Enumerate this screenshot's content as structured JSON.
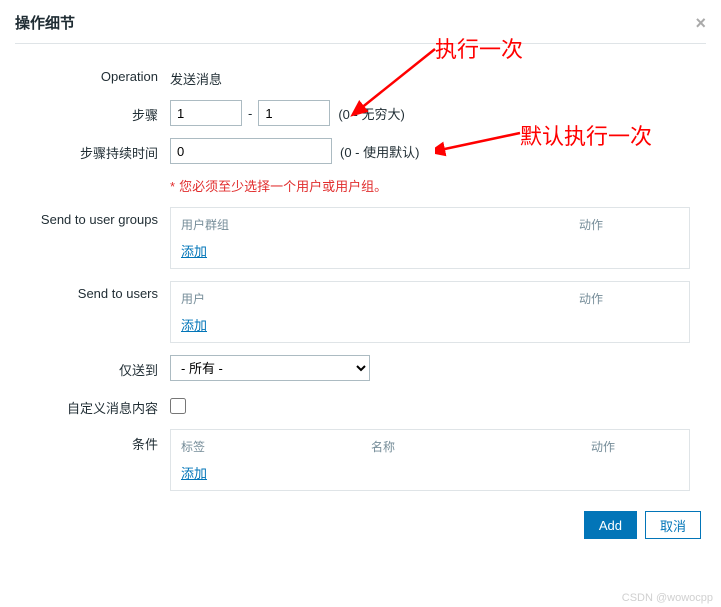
{
  "dialog": {
    "title": "操作细节",
    "close": "×"
  },
  "form": {
    "operation_label": "Operation",
    "operation_value": "发送消息",
    "steps_label": "步骤",
    "steps_from": "1",
    "steps_dash": "-",
    "steps_to": "1",
    "steps_hint": "(0 - 无穷大)",
    "duration_label": "步骤持续时间",
    "duration_value": "0",
    "duration_hint": "(0 - 使用默认)",
    "validation_msg": "您必须至少选择一个用户或用户组。",
    "groups_label": "Send to user groups",
    "groups_col1": "用户群组",
    "groups_col2": "动作",
    "groups_add": "添加",
    "users_label": "Send to users",
    "users_col1": "用户",
    "users_col2": "动作",
    "users_add": "添加",
    "sendto_label": "仅送到",
    "sendto_value": "- 所有 -",
    "custom_label": "自定义消息内容",
    "conditions_label": "条件",
    "cond_col1": "标签",
    "cond_col2": "名称",
    "cond_col3": "动作",
    "cond_add": "添加"
  },
  "footer": {
    "add": "Add",
    "cancel": "取消"
  },
  "annotations": {
    "a1": "执行一次",
    "a2": "默认执行一次"
  },
  "watermark": "CSDN @wowocpp"
}
